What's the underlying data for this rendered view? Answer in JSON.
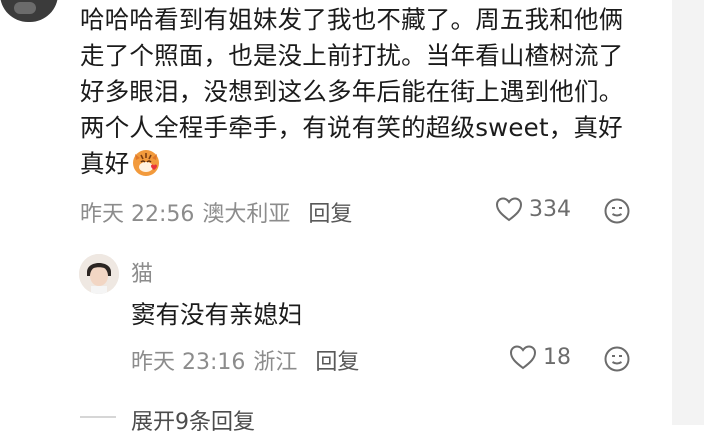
{
  "comment": {
    "text": "哈哈哈看到有姐妹发了我也不藏了。周五我和他俩走了个照面，也是没上前打扰。当年看山楂树流了好多眼泪，没想到这么多年后能在街上遇到他们。两个人全程手牵手，有说有笑的超级sweet，真好真好",
    "emoji_icon": "tiger-heart-emoji",
    "time": "昨天 22:56",
    "location": "澳大利亚",
    "reply_label": "回复",
    "likes": "334"
  },
  "reply": {
    "username": "猫",
    "text": "窦有没有亲媳妇",
    "time": "昨天 23:16",
    "location": "浙江",
    "reply_label": "回复",
    "likes": "18"
  },
  "expand_label": "展开9条回复"
}
